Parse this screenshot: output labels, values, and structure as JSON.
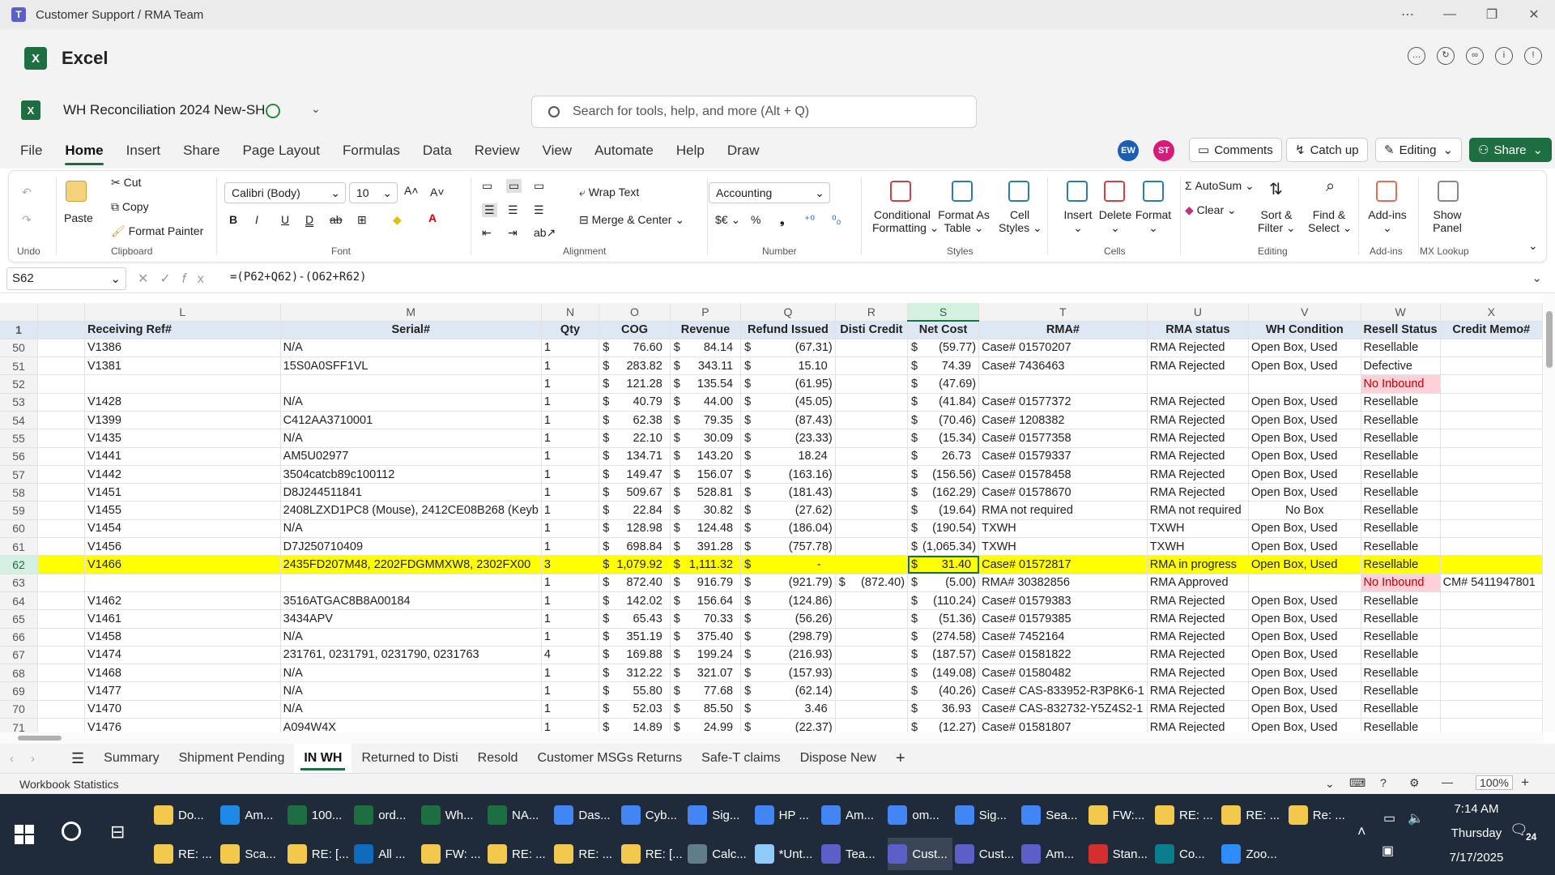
{
  "window": {
    "title": "Customer Support / RMA Team"
  },
  "app": {
    "name": "Excel"
  },
  "doc": {
    "name": "WH Reconciliation 2024 New-SH"
  },
  "search": {
    "placeholder": "Search for tools, help, and more (Alt + Q)"
  },
  "menu": [
    "File",
    "Home",
    "Insert",
    "Share",
    "Page Layout",
    "Formulas",
    "Data",
    "Review",
    "View",
    "Automate",
    "Help",
    "Draw"
  ],
  "menu_active": "Home",
  "avatars": [
    {
      "initials": "EW",
      "color": "#1a5fb4"
    },
    {
      "initials": "ST",
      "color": "#d81b7a"
    }
  ],
  "buttons": {
    "comments": "Comments",
    "catchup": "Catch up",
    "editing": "Editing",
    "share": "Share"
  },
  "ribbon": {
    "undo_group": "Undo",
    "clipboard": {
      "paste": "Paste",
      "cut": "Cut",
      "copy": "Copy",
      "painter": "Format Painter",
      "label": "Clipboard"
    },
    "font": {
      "name": "Calibri (Body)",
      "size": "10",
      "label": "Font"
    },
    "alignment": {
      "wrap": "Wrap Text",
      "merge": "Merge & Center",
      "label": "Alignment"
    },
    "number": {
      "format": "Accounting",
      "label": "Number"
    },
    "styles": {
      "cond1": "Conditional",
      "cond2": "Formatting",
      "fmt1": "Format As",
      "fmt2": "Table",
      "cell1": "Cell",
      "cell2": "Styles",
      "label": "Styles"
    },
    "cells": {
      "insert": "Insert",
      "delete": "Delete",
      "format": "Format",
      "label": "Cells"
    },
    "editing": {
      "autosum": "AutoSum",
      "clear": "Clear",
      "sort1": "Sort &",
      "sort2": "Filter",
      "find1": "Find &",
      "find2": "Select",
      "label": "Editing"
    },
    "addins": {
      "btn": "Add-ins",
      "label": "Add-ins"
    },
    "mx": {
      "btn1": "Show",
      "btn2": "Panel",
      "label": "MX Lookup"
    }
  },
  "formula_bar": {
    "cell": "S62",
    "formula": "=(P62+Q62)-(O62+R62)"
  },
  "columns": [
    "L",
    "M",
    "N",
    "O",
    "P",
    "Q",
    "R",
    "S",
    "T",
    "U",
    "V",
    "W",
    "X"
  ],
  "headers": [
    "Receiving Ref#",
    "Serial#",
    "Qty",
    "COG",
    "Revenue",
    "Refund Issued",
    "Disti Credit",
    "Net Cost",
    "RMA#",
    "RMA status",
    "WH Condition",
    "Resell Status",
    "Credit Memo#"
  ],
  "rows": [
    {
      "r": "50",
      "ref": "V1386",
      "serial": "N/A",
      "qty": "1",
      "cog": "76.60",
      "rev": "84.14",
      "refund": "(67.31)",
      "disti": "",
      "net": "(59.77)",
      "rma": "Case# 01570207",
      "status": "RMA Rejected",
      "cond": "Open Box, Used",
      "resell": "Resellable",
      "memo": ""
    },
    {
      "r": "51",
      "ref": "V1381",
      "serial": "15S0A0SFF1VL",
      "qty": "1",
      "cog": "283.82",
      "rev": "343.11",
      "refund": "15.10",
      "disti": "",
      "net": "74.39",
      "rma": "Case# 7436463",
      "status": "RMA Rejected",
      "cond": "Open Box, Used",
      "resell": "Defective",
      "memo": ""
    },
    {
      "r": "52",
      "ref": "",
      "serial": "",
      "qty": "1",
      "cog": "121.28",
      "rev": "135.54",
      "refund": "(61.95)",
      "disti": "",
      "net": "(47.69)",
      "rma": "",
      "status": "",
      "cond": "",
      "resell": "No Inbound",
      "memo": ""
    },
    {
      "r": "53",
      "ref": "V1428",
      "serial": "N/A",
      "qty": "1",
      "cog": "40.79",
      "rev": "44.00",
      "refund": "(45.05)",
      "disti": "",
      "net": "(41.84)",
      "rma": "Case# 01577372",
      "status": "RMA Rejected",
      "cond": "Open Box, Used",
      "resell": "Resellable",
      "memo": ""
    },
    {
      "r": "54",
      "ref": "V1399",
      "serial": "C412AA3710001",
      "qty": "1",
      "cog": "62.38",
      "rev": "79.35",
      "refund": "(87.43)",
      "disti": "",
      "net": "(70.46)",
      "rma": "Case# 1208382",
      "status": "RMA Rejected",
      "cond": "Open Box, Used",
      "resell": "Resellable",
      "memo": ""
    },
    {
      "r": "55",
      "ref": "V1435",
      "serial": " N/A",
      "qty": "1",
      "cog": "22.10",
      "rev": "30.09",
      "refund": "(23.33)",
      "disti": "",
      "net": "(15.34)",
      "rma": "Case# 01577358",
      "status": "RMA Rejected",
      "cond": "Open Box, Used",
      "resell": "Resellable",
      "memo": ""
    },
    {
      "r": "56",
      "ref": "V1441",
      "serial": "AM5U02977",
      "qty": "1",
      "cog": "134.71",
      "rev": "143.20",
      "refund": "18.24",
      "disti": "",
      "net": "26.73",
      "rma": "Case# 01579337",
      "status": "RMA Rejected",
      "cond": "Open Box, Used",
      "resell": "Resellable",
      "memo": ""
    },
    {
      "r": "57",
      "ref": "V1442",
      "serial": "3504catcb89c100112",
      "qty": "1",
      "cog": "149.47",
      "rev": "156.07",
      "refund": "(163.16)",
      "disti": "",
      "net": "(156.56)",
      "rma": "Case# 01578458",
      "status": "RMA Rejected",
      "cond": "Open Box, Used",
      "resell": "Resellable",
      "memo": ""
    },
    {
      "r": "58",
      "ref": "V1451",
      "serial": "D8J244511841",
      "qty": "1",
      "cog": "509.67",
      "rev": "528.81",
      "refund": "(181.43)",
      "disti": "",
      "net": "(162.29)",
      "rma": "Case# 01578670",
      "status": "RMA Rejected",
      "cond": "Open Box, Used",
      "resell": "Resellable",
      "memo": ""
    },
    {
      "r": "59",
      "ref": "V1455",
      "serial": "2408LZXD1PC8 (Mouse), 2412CE08B268 (Keyb",
      "qty": "1",
      "cog": "22.84",
      "rev": "30.82",
      "refund": "(27.62)",
      "disti": "",
      "net": "(19.64)",
      "rma": "RMA not required",
      "status": "RMA not required",
      "cond": "No Box",
      "resell": "Resellable",
      "memo": ""
    },
    {
      "r": "60",
      "ref": "V1454",
      "serial": "N/A",
      "qty": "1",
      "cog": "128.98",
      "rev": "124.48",
      "refund": "(186.04)",
      "disti": "",
      "net": "(190.54)",
      "rma": "TXWH",
      "status": "TXWH",
      "cond": "Open Box, Used",
      "resell": "Resellable",
      "memo": ""
    },
    {
      "r": "61",
      "ref": "V1456",
      "serial": "D7J250710409",
      "qty": "1",
      "cog": "698.84",
      "rev": "391.28",
      "refund": "(757.78)",
      "disti": "",
      "net": "(1,065.34)",
      "rma": "TXWH",
      "status": "TXWH",
      "cond": "Open Box, Used",
      "resell": "Resellable",
      "memo": ""
    },
    {
      "r": "62",
      "ref": "V1466",
      "serial": "2435FD207M48, 2202FDGMMXW8, 2302FX00",
      "qty": "3",
      "cog": "1,079.92",
      "rev": "1,111.32",
      "refund": "-",
      "disti": "",
      "net": "31.40",
      "rma": "Case# 01572817",
      "status": "RMA in progress",
      "cond": "Open Box, Used",
      "resell": "Resellable",
      "memo": ""
    },
    {
      "r": "63",
      "ref": "",
      "serial": "",
      "qty": "1",
      "cog": "872.40",
      "rev": "916.79",
      "refund": "(921.79)",
      "disti": "(872.40)",
      "net": "(5.00)",
      "rma": "RMA# 30382856",
      "status": "RMA Approved",
      "cond": "",
      "resell": "No Inbound",
      "memo": "CM# 5411947801"
    },
    {
      "r": "64",
      "ref": "V1462",
      "serial": "3516ATGAC8B8A00184",
      "qty": "1",
      "cog": "142.02",
      "rev": "156.64",
      "refund": "(124.86)",
      "disti": "",
      "net": "(110.24)",
      "rma": "Case# 01579383",
      "status": "RMA Rejected",
      "cond": "Open Box, Used",
      "resell": "Resellable",
      "memo": ""
    },
    {
      "r": "65",
      "ref": "V1461",
      "serial": "3434APV",
      "qty": "1",
      "cog": "65.43",
      "rev": "70.33",
      "refund": "(56.26)",
      "disti": "",
      "net": "(51.36)",
      "rma": "Case# 01579385",
      "status": "RMA Rejected",
      "cond": "Open Box, Used",
      "resell": "Resellable",
      "memo": ""
    },
    {
      "r": "66",
      "ref": "V1458",
      "serial": "N/A",
      "qty": "1",
      "cog": "351.19",
      "rev": "375.40",
      "refund": "(298.79)",
      "disti": "",
      "net": "(274.58)",
      "rma": "Case# 7452164",
      "status": "RMA Rejected",
      "cond": "Open Box, Used",
      "resell": "Resellable",
      "memo": ""
    },
    {
      "r": "67",
      "ref": "V1474",
      "serial": "231761, 0231791, 0231790, 0231763",
      "qty": "4",
      "cog": "169.88",
      "rev": "199.24",
      "refund": "(216.93)",
      "disti": "",
      "net": "(187.57)",
      "rma": "Case# 01581822",
      "status": "RMA Rejected",
      "cond": "Open Box, Used",
      "resell": "Resellable",
      "memo": ""
    },
    {
      "r": "68",
      "ref": "V1468",
      "serial": "N/A",
      "qty": "1",
      "cog": "312.22",
      "rev": "321.07",
      "refund": "(157.93)",
      "disti": "",
      "net": "(149.08)",
      "rma": "Case# 01580482",
      "status": "RMA Rejected",
      "cond": "Open Box, Used",
      "resell": "Resellable",
      "memo": ""
    },
    {
      "r": "69",
      "ref": "V1477",
      "serial": "N/A",
      "qty": "1",
      "cog": "55.80",
      "rev": "77.68",
      "refund": "(62.14)",
      "disti": "",
      "net": "(40.26)",
      "rma": "Case# CAS-833952-R3P8K6-1",
      "status": "RMA Rejected",
      "cond": "Open Box, Used",
      "resell": "Resellable",
      "memo": ""
    },
    {
      "r": "70",
      "ref": "V1470",
      "serial": "N/A",
      "qty": "1",
      "cog": "52.03",
      "rev": "85.50",
      "refund": "3.46",
      "disti": "",
      "net": "36.93",
      "rma": "Case# CAS-832732-Y5Z4S2-1",
      "status": "RMA Rejected",
      "cond": "Open Box, Used",
      "resell": "Resellable",
      "memo": ""
    },
    {
      "r": "71",
      "ref": "V1476",
      "serial": "A094W4X",
      "qty": "1",
      "cog": "14.89",
      "rev": "24.99",
      "refund": "(22.37)",
      "disti": "",
      "net": "(12.27)",
      "rma": "Case# 01581807",
      "status": "RMA Rejected",
      "cond": "Open Box, Used",
      "resell": "Resellable",
      "memo": ""
    }
  ],
  "sheets": [
    "Summary",
    "Shipment Pending",
    "IN WH",
    "Returned to Disti",
    "Resold",
    "Customer MSGs Returns",
    "Safe-T claims",
    "Dispose New"
  ],
  "active_sheet": "IN WH",
  "status": {
    "left": "Workbook Statistics",
    "zoom": "100%"
  },
  "taskbar": {
    "row1": [
      "Do...",
      "Am...",
      "100...",
      "ord...",
      "Wh...",
      "NA...",
      "Das...",
      "Cyb...",
      "Sig...",
      "HP ...",
      "Am...",
      "om...",
      "Sig...",
      "Sea...",
      "FW:...",
      "RE: ...",
      "RE: ...",
      "Re: ..."
    ],
    "row2": [
      "RE: ...",
      "Sca...",
      "RE: [...",
      "All ...",
      "FW: ...",
      "RE: ...",
      "RE: ...",
      "RE: [...",
      "Calc...",
      "*Unt...",
      "Tea...",
      "Cust...",
      "Cust...",
      "Am...",
      "Stan...",
      "Co...",
      "Zoo..."
    ],
    "time": "7:14 AM",
    "day": "Thursday",
    "date": "7/17/2025",
    "notif": "24"
  }
}
